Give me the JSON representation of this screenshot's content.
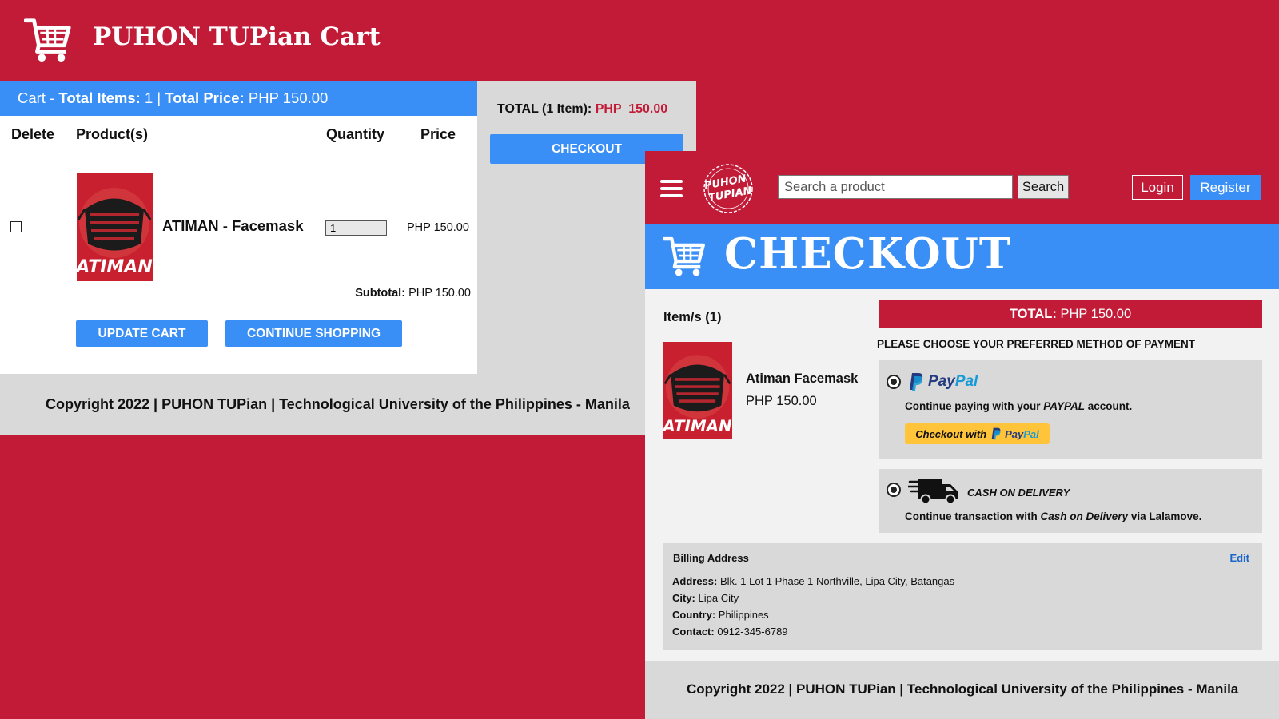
{
  "site": {
    "title": "PUHON TUPian Cart"
  },
  "cart": {
    "summary": {
      "prefix": "Cart - ",
      "total_items_label": "Total Items:",
      "total_items_value": "1",
      "separator": "|",
      "total_price_label": "Total Price:",
      "total_price_value": "PHP 150.00"
    },
    "columns": {
      "delete": "Delete",
      "products": "Product(s)",
      "quantity": "Quantity",
      "price": "Price"
    },
    "item": {
      "name": "ATIMAN - Facemask",
      "quantity": "1",
      "price": "PHP 150.00",
      "image_text": "ATIMAN",
      "checked": false
    },
    "subtotal_label": "Subtotal:",
    "subtotal_value": "PHP 150.00",
    "update_button": "UPDATE CART",
    "continue_button": "CONTINUE SHOPPING",
    "side": {
      "total_label": "TOTAL (1 Item):",
      "total_value": "PHP  150.00",
      "checkout_button": "CHECKOUT"
    },
    "footer": "Copyright 2022 | PUHON TUPian | Technological University of the Philippines - Manila"
  },
  "checkout": {
    "navbar": {
      "logo_text_1": "PUHON",
      "logo_text_2": "TUPIAN",
      "search_placeholder": "Search a product",
      "search_button": "Search",
      "login": "Login",
      "register": "Register"
    },
    "banner_title": "CHECKOUT",
    "items_heading": "Item/s (1)",
    "item": {
      "name": "Atiman Facemask",
      "price": "PHP 150.00",
      "image_text": "ATIMAN"
    },
    "total_label": "TOTAL:",
    "total_value": "PHP 150.00",
    "payment_heading": "PLEASE CHOOSE YOUR PREFERRED METHOD OF PAYMENT",
    "paypal": {
      "logo_pay": "Pay",
      "logo_pal": "Pal",
      "desc_prefix": "Continue paying with your ",
      "desc_emph": "PAYPAL",
      "desc_suffix": " account.",
      "button_prefix": "Checkout with",
      "selected": true
    },
    "cod": {
      "title": "CASH ON DELIVERY",
      "desc_prefix": "Continue transaction with ",
      "desc_emph": "Cash on Delivery",
      "desc_suffix": " via Lalamove.",
      "selected": true
    },
    "billing": {
      "title": "Billing Address",
      "edit": "Edit",
      "address_label": "Address:",
      "address_value": "Blk. 1 Lot 1 Phase 1 Northville, Lipa City, Batangas",
      "city_label": "City:",
      "city_value": "Lipa City",
      "country_label": "Country:",
      "country_value": "Philippines",
      "contact_label": "Contact:",
      "contact_value": "0912-345-6789"
    },
    "footer": "Copyright 2022 | PUHON TUPian | Technological University of the Philippines - Manila"
  },
  "colors": {
    "brand_red": "#c21b37",
    "accent_blue": "#3a8ff7",
    "panel_gray": "#d9d9d9",
    "paypal_yellow": "#ffc439"
  },
  "icons": [
    "shopping-cart-icon",
    "hamburger-icon",
    "paypal-icon",
    "delivery-truck-icon"
  ]
}
